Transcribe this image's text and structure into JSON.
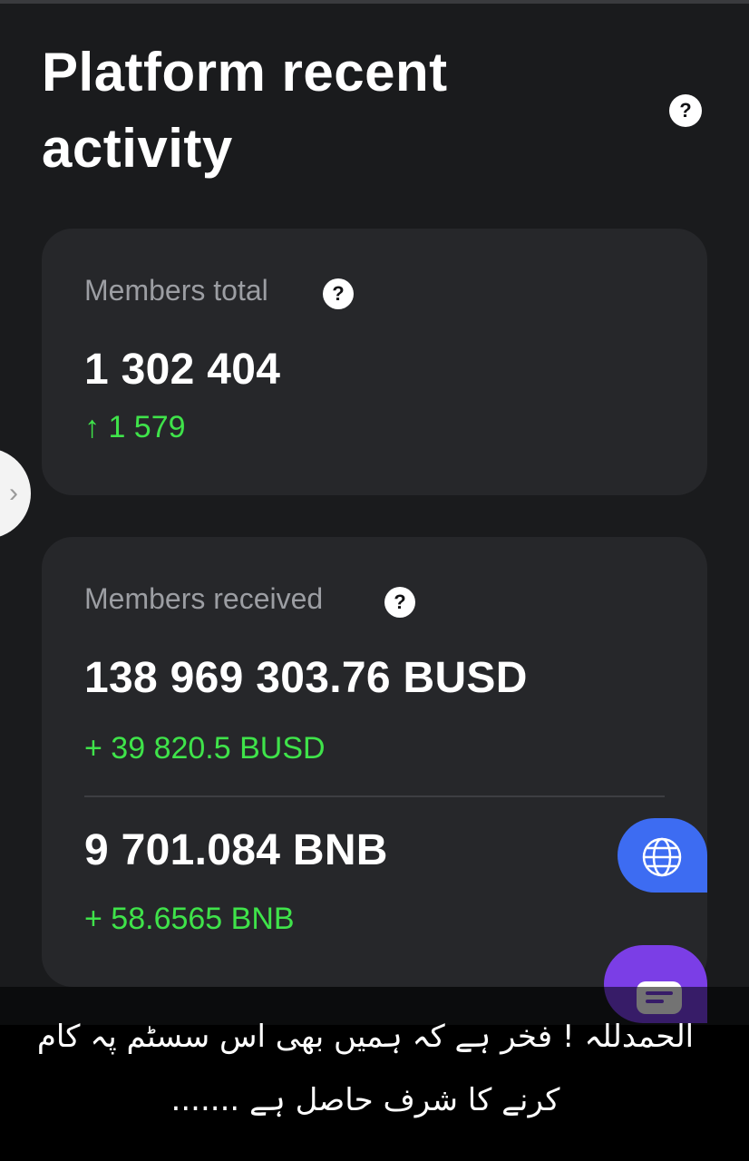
{
  "header": {
    "title": "Platform recent activity",
    "help_icon": "question-circle-icon"
  },
  "members_total": {
    "label": "Members total",
    "value": "1 302 404",
    "delta": "↑ 1 579"
  },
  "members_received": {
    "label": "Members received",
    "busd_value": "138 969 303.76 BUSD",
    "busd_delta": "+ 39 820.5 BUSD",
    "bnb_value": "9 701.084 BNB",
    "bnb_delta": "+ 58.6565 BNB"
  },
  "side_tab": {
    "icon": "chevron-right-icon",
    "glyph": "›"
  },
  "floating_buttons": {
    "language_icon": "globe-icon",
    "chat_icon": "chat-icon"
  },
  "caption": {
    "text": "الحمدللہ ! فخر ہے کہ ہمیں بھی اس سسٹم پہ کام کرنے کا شرف حاصل ہے ......."
  },
  "colors": {
    "background": "#1a1b1d",
    "card": "#26272a",
    "positive": "#3fe34a",
    "language_button": "#3d6cf2",
    "chat_button": "#7b3ee6"
  }
}
